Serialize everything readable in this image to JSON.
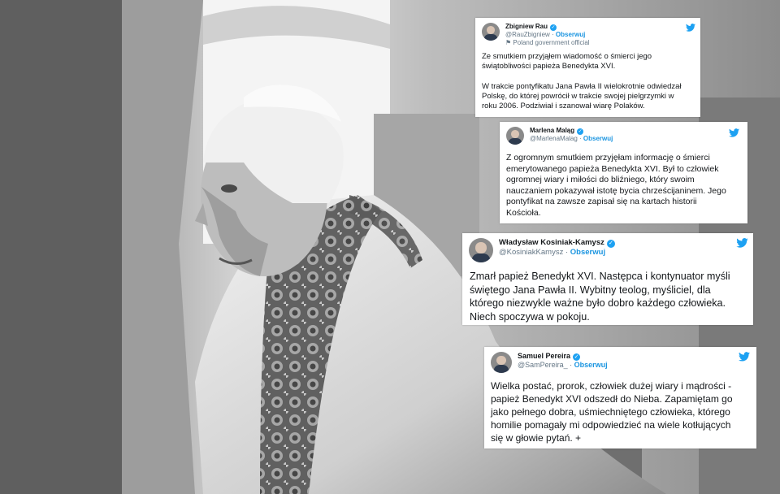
{
  "tweets": [
    {
      "name": "Zbigniew Rau",
      "handle": "@RauZbigniew",
      "follow": "Obserwuj",
      "label": "Poland government official",
      "text": "Ze smutkiem przyjąłem wiadomość o śmierci jego\nświątobliwości papieża Benedykta XVI.\n\nW trakcie pontyfikatu Jana Pawła II wielokrotnie odwiedzał\nPolskę, do której powrócił w trakcie swojej pielgrzymki w\nroku 2006. Podziwiał i szanował wiarę Polaków."
    },
    {
      "name": "Marlena Maląg",
      "handle": "@MarlenaMalag",
      "follow": "Obserwuj",
      "text": "Z ogromnym smutkiem przyjęłam informację o śmierci\nemerytowanego papieża Benedykta XVI. Był to człowiek\nogromnej wiary i miłości do bliźniego, który swoim\nnauczaniem pokazywał istotę bycia chrześcijaninem. Jego\npontyfikat na zawsze zapisał się na kartach historii\nKościoła."
    },
    {
      "name": "Władysław Kosiniak-Kamysz",
      "handle": "@KosiniakKamysz",
      "follow": "Obserwuj",
      "text": "Zmarł papież Benedykt XVI. Następca i kontynuator myśli\nświętego Jana Pawła II. Wybitny teolog, myśliciel, dla\nktórego niezwykle ważne było dobro każdego człowieka.\nNiech spoczywa w pokoju."
    },
    {
      "name": "Samuel Pereira",
      "handle": "@SamPereira_",
      "follow": "Obserwuj",
      "text": "Wielka postać, prorok, człowiek dużej wiary i mądrości -\npapież Benedykt XVI odszedł do Nieba. Zapamiętam go\njako pełnego dobra, uśmiechniętego człowieka, którego\nhomilie pomagały mi odpowiedzieć na wiele kotłujących\nsię w głowie pytań. +"
    }
  ],
  "icons": {
    "verified": "verified-badge-icon",
    "bird": "twitter-bird-icon",
    "flag": "flag-icon"
  }
}
